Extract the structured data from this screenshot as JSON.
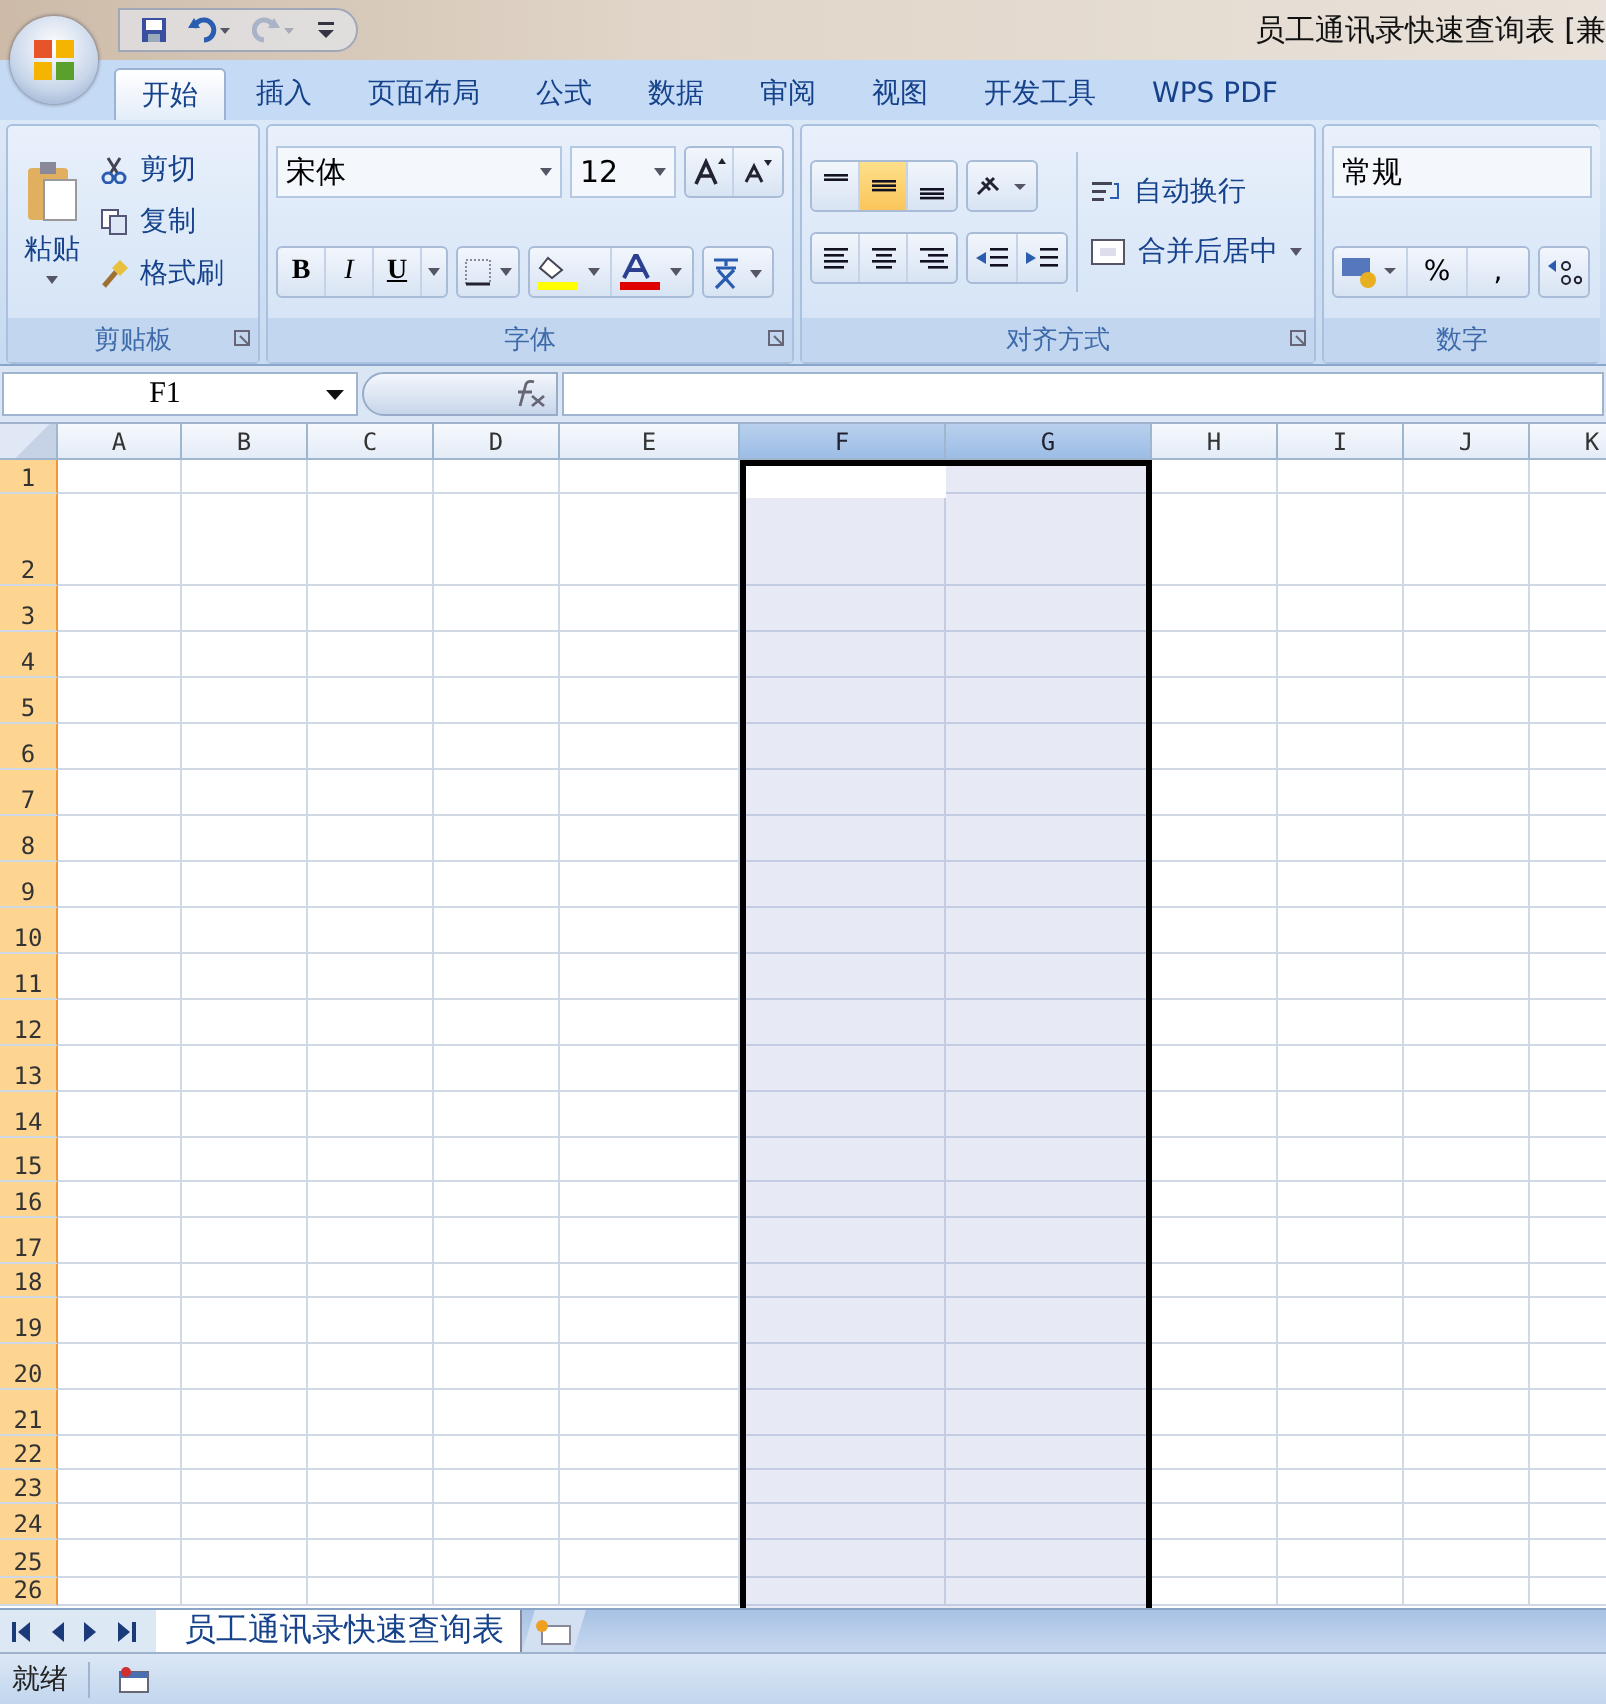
{
  "window": {
    "title": "员工通讯录快速查询表 [兼"
  },
  "ribbon_tabs": [
    {
      "label": "开始",
      "selected": true
    },
    {
      "label": "插入",
      "selected": false
    },
    {
      "label": "页面布局",
      "selected": false
    },
    {
      "label": "公式",
      "selected": false
    },
    {
      "label": "数据",
      "selected": false
    },
    {
      "label": "审阅",
      "selected": false
    },
    {
      "label": "视图",
      "selected": false
    },
    {
      "label": "开发工具",
      "selected": false
    },
    {
      "label": "WPS PDF",
      "selected": false
    }
  ],
  "clipboard": {
    "paste": "粘贴",
    "cut": "剪切",
    "copy": "复制",
    "format_painter": "格式刷",
    "group": "剪贴板"
  },
  "font": {
    "name": "宋体",
    "size": "12",
    "bold": "B",
    "italic": "I",
    "underline": "U",
    "group": "字体"
  },
  "alignment": {
    "vertical": [
      {
        "kind": "top",
        "selected": false
      },
      {
        "kind": "middle",
        "selected": true
      },
      {
        "kind": "bottom",
        "selected": false
      }
    ],
    "wrap": "自动换行",
    "merge": "合并后居中",
    "group": "对齐方式"
  },
  "number": {
    "format": "常规",
    "percent": "%",
    "comma": ",",
    "group": "数字"
  },
  "name_box": "F1",
  "columns": [
    {
      "label": "A",
      "selected": false
    },
    {
      "label": "B",
      "selected": false
    },
    {
      "label": "C",
      "selected": false
    },
    {
      "label": "D",
      "selected": false
    },
    {
      "label": "E",
      "selected": false
    },
    {
      "label": "F",
      "selected": true
    },
    {
      "label": "G",
      "selected": true
    },
    {
      "label": "H",
      "selected": false
    },
    {
      "label": "I",
      "selected": false
    },
    {
      "label": "J",
      "selected": false
    },
    {
      "label": "K",
      "selected": false
    }
  ],
  "rows": [
    {
      "label": "1",
      "selected": true
    },
    {
      "label": "2",
      "selected": true
    },
    {
      "label": "3",
      "selected": true
    },
    {
      "label": "4",
      "selected": true
    },
    {
      "label": "5",
      "selected": true
    },
    {
      "label": "6",
      "selected": true
    },
    {
      "label": "7",
      "selected": true
    },
    {
      "label": "8",
      "selected": true
    },
    {
      "label": "9",
      "selected": true
    },
    {
      "label": "10",
      "selected": true
    },
    {
      "label": "11",
      "selected": true
    },
    {
      "label": "12",
      "selected": true
    },
    {
      "label": "13",
      "selected": true
    },
    {
      "label": "14",
      "selected": true
    },
    {
      "label": "15",
      "selected": true
    },
    {
      "label": "16",
      "selected": true
    },
    {
      "label": "17",
      "selected": true
    },
    {
      "label": "18",
      "selected": true
    },
    {
      "label": "19",
      "selected": true
    },
    {
      "label": "20",
      "selected": true
    },
    {
      "label": "21",
      "selected": true
    },
    {
      "label": "22",
      "selected": true
    },
    {
      "label": "23",
      "selected": true
    },
    {
      "label": "24",
      "selected": true
    },
    {
      "label": "25",
      "selected": true
    },
    {
      "label": "26",
      "selected": true
    }
  ],
  "sheets": [
    {
      "label": "员工通讯录快速查询表",
      "selected": true
    }
  ],
  "status_bar": {
    "text": "就绪"
  }
}
